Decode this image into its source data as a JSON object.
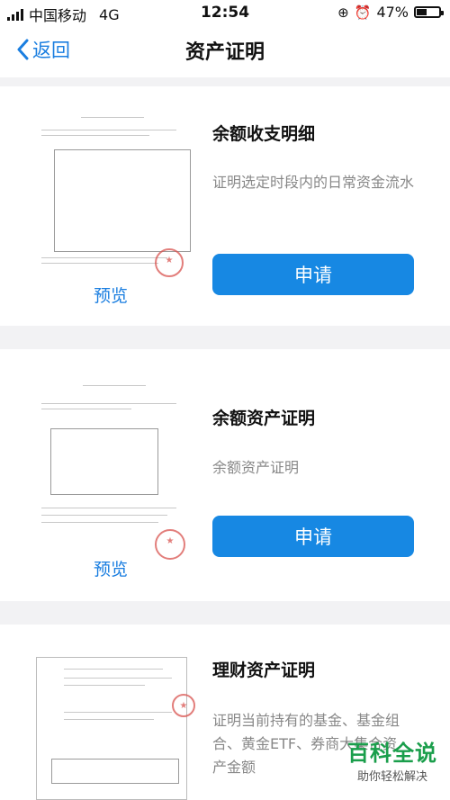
{
  "status_bar": {
    "carrier": "中国移动",
    "network": "4G",
    "time": "12:54",
    "battery_percent": "47%",
    "battery_level": 0.47
  },
  "nav": {
    "back_label": "返回",
    "title": "资产证明"
  },
  "cards": [
    {
      "title": "余额收支明细",
      "description": "证明选定时段内的日常资金流水",
      "preview_label": "预览",
      "apply_label": "申请"
    },
    {
      "title": "余额资产证明",
      "description": "余额资产证明",
      "preview_label": "预览",
      "apply_label": "申请"
    },
    {
      "title": "理财资产证明",
      "description": "证明当前持有的基金、基金组合、黄金ETF、券商大集合资产金额"
    }
  ],
  "watermark": {
    "main": "百科全说",
    "sub": "助你轻松解决"
  },
  "colors": {
    "accent": "#1788e3",
    "link": "#1a7ee0",
    "stamp": "#d9534f",
    "watermark": "#1a9e4b"
  }
}
